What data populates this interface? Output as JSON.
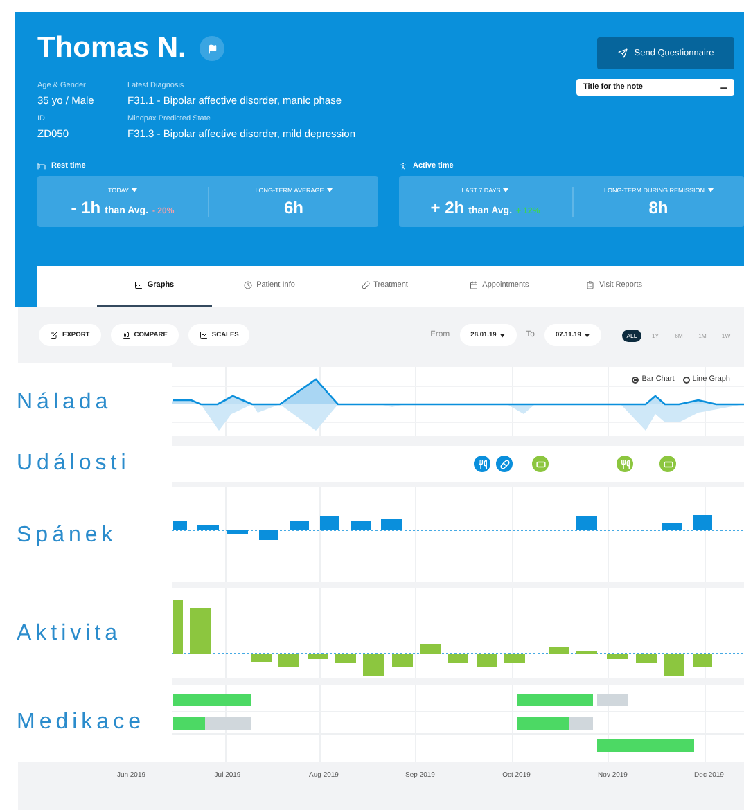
{
  "patient": {
    "name": "Thomas N."
  },
  "info": [
    {
      "label": "Age & Gender",
      "value": "35 yo / Male"
    },
    {
      "label": "Latest Diagnosis",
      "value": "F31.1 - Bipolar affective disorder, manic phase"
    },
    {
      "label": "ID",
      "value": "ZD050"
    },
    {
      "label": "Mindpax Predicted State",
      "value": "F31.3 - Bipolar affective disorder, mild depression"
    }
  ],
  "send_button": "Send Questionnaire",
  "note": {
    "value": "Title for the note"
  },
  "stats": [
    {
      "kind": "rest",
      "title": "Rest time",
      "cards": [
        {
          "period": "TODAY",
          "value": "- 1h",
          "suffix": "than Avg.",
          "change": "- 20%",
          "color": "#f3a0a8"
        },
        {
          "period": "LONG-TERM AVERAGE",
          "value": "6h"
        }
      ]
    },
    {
      "kind": "active",
      "title": "Active time",
      "cards": [
        {
          "period": "LAST 7 DAYS",
          "value": "+ 2h",
          "suffix": "than Avg.",
          "change": "+ 12%",
          "color": "#3ed35a"
        },
        {
          "period": "LONG-TERM DURING REMISSION",
          "value": "8h"
        }
      ]
    }
  ],
  "tabs": [
    {
      "kind": "graphs",
      "label": "Graphs",
      "selected": true
    },
    {
      "kind": "info",
      "label": "Patient Info",
      "selected": false
    },
    {
      "kind": "treatment",
      "label": "Treatment",
      "selected": false
    },
    {
      "kind": "appointments",
      "label": "Appointments",
      "selected": false
    },
    {
      "kind": "reports",
      "label": "Visit Reports",
      "selected": false
    }
  ],
  "toolbar": {
    "buttons": [
      {
        "kind": "export",
        "label": "EXPORT"
      },
      {
        "kind": "compare",
        "label": "COMPARE"
      },
      {
        "kind": "scales",
        "label": "SCALES"
      }
    ],
    "from_label": "From",
    "from": "28.01.19",
    "to_label": "To",
    "to": "07.11.19",
    "ranges": [
      {
        "label": "ALL",
        "selected": true
      },
      {
        "label": "1Y",
        "selected": false
      },
      {
        "label": "6M",
        "selected": false
      },
      {
        "label": "1M",
        "selected": false
      },
      {
        "label": "1W",
        "selected": false
      }
    ]
  },
  "chart_type": [
    {
      "label": "Bar Chart",
      "selected": true
    },
    {
      "label": "Line Graph",
      "selected": false
    }
  ],
  "rows": [
    {
      "kind": "mood",
      "label": "Nálada"
    },
    {
      "kind": "events",
      "label": "Události"
    },
    {
      "kind": "sleep",
      "label": "Spánek"
    },
    {
      "kind": "activity",
      "label": "Aktivita"
    },
    {
      "kind": "medication",
      "label": "Medikace"
    }
  ],
  "events": [
    {
      "kind": "meal",
      "color": "#0a8fdc"
    },
    {
      "kind": "pill",
      "color": "#0a8fdc"
    },
    {
      "kind": "screen",
      "color": "#8cc63f"
    },
    {
      "kind": "meal",
      "color": "#8cc63f"
    },
    {
      "kind": "screen",
      "color": "#8cc63f"
    }
  ],
  "months": [
    "Jun 2019",
    "Jul 2019",
    "Aug 2019",
    "Sep 2019",
    "Oct 2019",
    "Nov 2019",
    "Dec 2019"
  ]
}
